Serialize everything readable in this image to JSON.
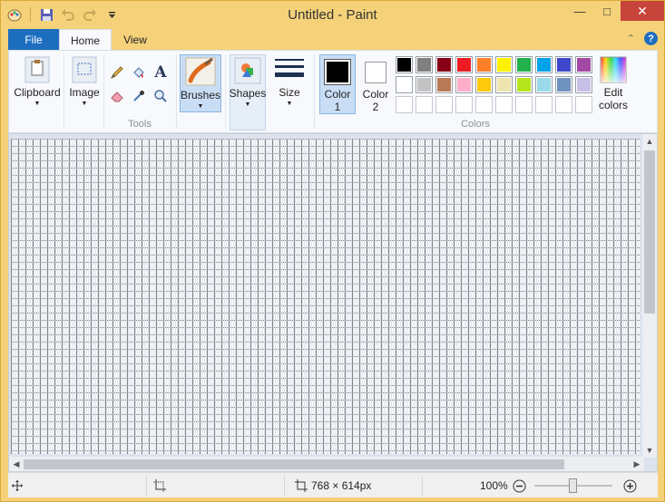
{
  "window": {
    "title": "Untitled - Paint"
  },
  "quick_access": [
    "paint-app-icon",
    "save-icon",
    "undo-icon",
    "redo-icon",
    "customize-dropdown-icon"
  ],
  "tabs": {
    "file": "File",
    "home": "Home",
    "view": "View"
  },
  "ribbon": {
    "clipboard": {
      "label": "Clipboard"
    },
    "image": {
      "label": "Image"
    },
    "tools": {
      "group_label": "Tools"
    },
    "brushes": {
      "label": "Brushes"
    },
    "shapes": {
      "label": "Shapes"
    },
    "size": {
      "label": "Size"
    },
    "color1": {
      "label": "Color",
      "label2": "1",
      "value": "#000000"
    },
    "color2": {
      "label": "Color",
      "label2": "2",
      "value": "#ffffff"
    },
    "colors": {
      "group_label": "Colors",
      "row1": [
        "#000000",
        "#7f7f7f",
        "#880015",
        "#ed1c24",
        "#ff7f27",
        "#fff200",
        "#22b14c",
        "#00a2e8",
        "#3f48cc",
        "#a349a4"
      ],
      "row2": [
        "#ffffff",
        "#c3c3c3",
        "#b97a57",
        "#ffaec9",
        "#ffc90e",
        "#efe4b0",
        "#b5e61d",
        "#99d9ea",
        "#7092be",
        "#c8bfe7"
      ],
      "row3_empty_count": 10
    },
    "edit_colors": {
      "label": "Edit",
      "label2": "colors"
    }
  },
  "status": {
    "dimensions": "768 × 614px",
    "zoom": "100%"
  },
  "colors": {
    "accent": "#1e6ebf",
    "frame": "#f5d27a",
    "close": "#c7443b"
  }
}
